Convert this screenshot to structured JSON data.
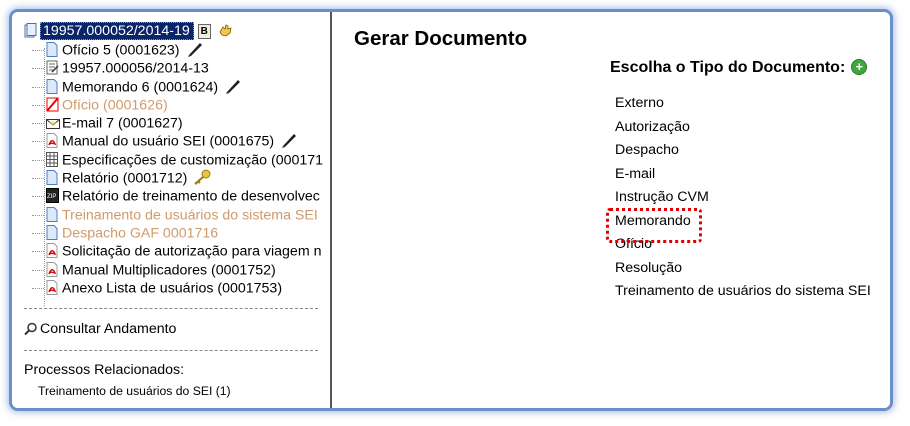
{
  "tree": {
    "root": {
      "label": "19957.000052/2014-19",
      "badge": "B"
    },
    "items": [
      {
        "label": "Ofício 5 (0001623)",
        "icon": "doc-icon",
        "signed": true,
        "orange": false
      },
      {
        "label": "19957.000056/2014-13",
        "icon": "process-icon",
        "signed": false,
        "orange": false
      },
      {
        "label": "Memorando 6 (0001624)",
        "icon": "doc-icon",
        "signed": true,
        "orange": false
      },
      {
        "label": "Ofício (0001626)",
        "icon": "cancelled-icon",
        "signed": false,
        "orange": true
      },
      {
        "label": "E-mail 7 (0001627)",
        "icon": "email-icon",
        "signed": false,
        "orange": false
      },
      {
        "label": "Manual do usuário SEI (0001675)",
        "icon": "pdf-icon",
        "signed": true,
        "orange": false
      },
      {
        "label": "Especificações de customização (000171",
        "icon": "spreadsheet-icon",
        "signed": false,
        "orange": false
      },
      {
        "label": "Relatório (0001712)",
        "icon": "doc-icon",
        "signed": false,
        "key": true,
        "orange": false
      },
      {
        "label": "Relatório de treinamento de desenvolvec",
        "icon": "zip-icon",
        "signed": false,
        "orange": false
      },
      {
        "label": "Treinamento de usuários do sistema SEI",
        "icon": "doc-icon",
        "signed": false,
        "orange": true
      },
      {
        "label": "Despacho GAF 0001716",
        "icon": "doc-icon",
        "signed": false,
        "orange": true
      },
      {
        "label": "Solicitação de autorização para viagem n",
        "icon": "pdf-icon",
        "signed": false,
        "orange": false
      },
      {
        "label": "Manual Multiplicadores (0001752)",
        "icon": "pdf-icon",
        "signed": false,
        "orange": false
      },
      {
        "label": "Anexo Lista de usuários (0001753)",
        "icon": "pdf-icon",
        "signed": false,
        "orange": false
      }
    ]
  },
  "consultar": "Consultar Andamento",
  "relacionados": {
    "title": "Processos Relacionados:",
    "items": [
      "Treinamento de usuários do SEI (1)"
    ]
  },
  "main": {
    "title": "Gerar Documento",
    "choose_label": "Escolha o Tipo do Documento:",
    "types": [
      "Externo",
      "Autorização",
      "Despacho",
      "E-mail",
      "Instrução CVM",
      "Memorando",
      "Ofício",
      "Resolução",
      "Treinamento de usuários do sistema SEI"
    ],
    "highlighted": "Memorando"
  },
  "colors": {
    "frame": "#6b8fc9",
    "selected_bg": "#0a246a",
    "orange_text": "#d09a6a",
    "highlight_box": "#e00000",
    "plus": "#3ea83e"
  }
}
